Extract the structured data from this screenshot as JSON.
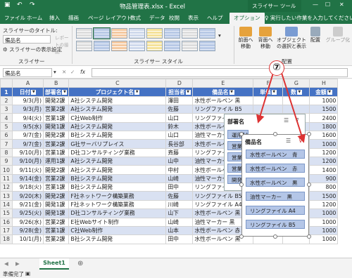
{
  "titlebar": {
    "title": "物品管理表.xlsx - Excel",
    "context_tab": "スライサー ツール"
  },
  "tabs": [
    "ファイル",
    "ホーム",
    "挿入",
    "描画",
    "ページ レイアウト",
    "数式",
    "データ",
    "校閲",
    "表示",
    "ヘルプ",
    "オプション"
  ],
  "tell_me": "実行したい作業を入力してください",
  "ribbon": {
    "caption_label": "スライサーのタイトル:",
    "caption_value": "備品名",
    "settings": "スライサーの表示設定",
    "group_slicer": "スライサー",
    "report_conn": "レポートの接続",
    "group_styles": "スライサー スタイル",
    "front": "前面へ移動",
    "back": "背面へ移動",
    "select_pane": "オブジェクトの選択と表示",
    "group_arrange": "配置",
    "align": "配置",
    "group_btn": "グループ化"
  },
  "name_box": "備品名",
  "fx": "fx",
  "col_letters": [
    "",
    "A",
    "B",
    "C",
    "D",
    "E",
    "F",
    "G",
    "H"
  ],
  "headers": [
    "日付",
    "部署名",
    "プロジェクト名",
    "担当者",
    "備品名",
    "単価",
    "数",
    "金額"
  ],
  "rows": [
    [
      "9/3(月)",
      "開発2課",
      "A社システム開発",
      "澤田",
      "水性ボールペン 黒",
      "",
      "",
      "1000"
    ],
    [
      "9/3(月)",
      "営業2課",
      "A社システム開発",
      "佐藤",
      "リングファイル B5",
      "",
      "",
      "1500"
    ],
    [
      "9/4(火)",
      "営業1課",
      "C社Web制作",
      "山口",
      "リングファイル A4",
      "",
      "",
      "2400"
    ],
    [
      "9/5(水)",
      "開発1課",
      "A社システム開発",
      "鈴木",
      "水性ボールペン 黒",
      "",
      "",
      "1800"
    ],
    [
      "9/7(金)",
      "開発2課",
      "B社システム開発",
      "山口",
      "油性マーカー 黒",
      "",
      "",
      "1600"
    ],
    [
      "9/7(金)",
      "営業2課",
      "G社サーバリプレイス",
      "長谷部",
      "水性ボールペン 赤",
      "",
      "",
      "1000"
    ],
    [
      "9/10(月)",
      "営業1課",
      "D社コンサルティング業務",
      "斉藤",
      "リングファイル B5",
      "",
      "",
      "1200"
    ],
    [
      "9/10(月)",
      "運用1課",
      "A社システム開発",
      "山中",
      "油性マーカー 黒",
      "",
      "",
      "1200"
    ],
    [
      "9/11(火)",
      "開発2課",
      "A社システム開発",
      "中村",
      "水性ボールペン 黒",
      "",
      "",
      "1400"
    ],
    [
      "9/14(金)",
      "営業2課",
      "B社システム開発",
      "山崎",
      "油性マーカー 黒",
      "",
      "",
      "900"
    ],
    [
      "9/18(火)",
      "営業1課",
      "B社システム開発",
      "田中",
      "リングファイル A4",
      "",
      "",
      "800"
    ],
    [
      "9/20(木)",
      "開発2課",
      "F社ネットワーク構築業務",
      "佐藤",
      "リングファイル B5",
      "",
      "",
      "1500"
    ],
    [
      "9/21(金)",
      "開発1課",
      "F社ネットワーク構築業務",
      "川崎",
      "リングファイル A4",
      "",
      "",
      "1200"
    ],
    [
      "9/25(火)",
      "開発1課",
      "D社コンサルティング業務",
      "山下",
      "水性ボールペン 黒",
      "",
      "",
      "1000"
    ],
    [
      "9/26(水)",
      "営業2課",
      "E社Webサイト制作",
      "山崎",
      "油性マーカー 黒",
      "",
      "",
      "1000"
    ],
    [
      "9/28(金)",
      "営業1課",
      "C社Web制作",
      "山本",
      "水性ボールペン 赤",
      "",
      "",
      "1000"
    ],
    [
      "10/1(月)",
      "営業2課",
      "B社システム開発",
      "田中",
      "水性ボールペン 黒",
      "",
      "",
      "1000"
    ]
  ],
  "row_numbers": [
    "1",
    "2",
    "3",
    "4",
    "5",
    "6",
    "7",
    "8",
    "9",
    "10",
    "11",
    "12",
    "13",
    "14",
    "15",
    "16",
    "17",
    "18"
  ],
  "slicer_dept": {
    "title": "部署名",
    "items": [
      "運用1課",
      "営業",
      "営業",
      "営業",
      "開発"
    ]
  },
  "slicer_item": {
    "title": "備品名",
    "items": [
      "水性ボールペン　青",
      "水性ボールペン　赤",
      "水性ボールペン　黒",
      "油性マーカー　黒",
      "リングファイル A4",
      "リングファイル B5"
    ]
  },
  "callout": "⑦",
  "sheet_tab": "Sheet1",
  "status": "準備完了"
}
